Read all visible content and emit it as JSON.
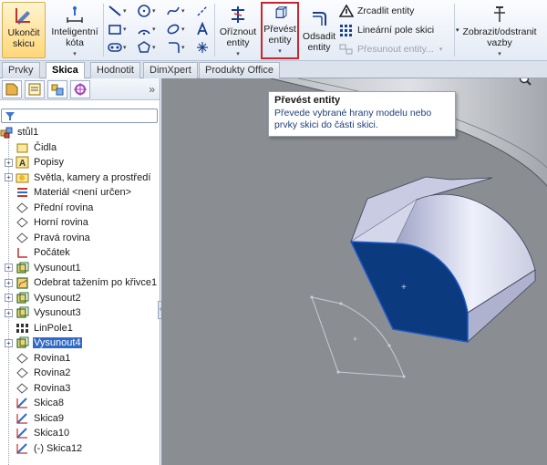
{
  "ribbon": {
    "exit_sketch": "Ukončit\nskicu",
    "smart_dimension": "Inteligentní\nkóta",
    "trim_entities": "Oříznout\nentity",
    "convert_entities": "Převést\nentity",
    "offset_entities": "Odsadit\nentity",
    "mirror_entities": "Zrcadlit entity",
    "linear_pattern": "Lineární pole skici",
    "move_entities": "Přesunout entity...",
    "display_relations": "Zobrazit/odstranit\nvazby"
  },
  "tabs": [
    "Prvky",
    "Skica",
    "Hodnotit",
    "DimXpert",
    "Produkty Office"
  ],
  "active_tab": "Skica",
  "tooltip": {
    "title": "Převést entity",
    "text": "Převede vybrané hrany modelu nebo prvky skici do části skici."
  },
  "tree": {
    "root": "stůl1",
    "items": [
      {
        "label": "Čidla",
        "expandable": false,
        "icon": "sensor-icon"
      },
      {
        "label": "Popisy",
        "expandable": true,
        "icon": "annotations-icon"
      },
      {
        "label": "Světla, kamery a prostředí",
        "expandable": true,
        "icon": "lights-icon"
      },
      {
        "label": "Materiál <není určen>",
        "expandable": false,
        "icon": "material-icon"
      },
      {
        "label": "Přední rovina",
        "expandable": false,
        "icon": "plane-icon"
      },
      {
        "label": "Horní rovina",
        "expandable": false,
        "icon": "plane-icon"
      },
      {
        "label": "Pravá rovina",
        "expandable": false,
        "icon": "plane-icon"
      },
      {
        "label": "Počátek",
        "expandable": false,
        "icon": "origin-icon"
      },
      {
        "label": "Vysunout1",
        "expandable": true,
        "icon": "extrude-icon"
      },
      {
        "label": "Odebrat tažením po křivce1",
        "expandable": true,
        "icon": "sweep-cut-icon"
      },
      {
        "label": "Vysunout2",
        "expandable": true,
        "icon": "extrude-icon"
      },
      {
        "label": "Vysunout3",
        "expandable": true,
        "icon": "extrude-icon"
      },
      {
        "label": "LinPole1",
        "expandable": false,
        "icon": "linear-pattern-icon"
      },
      {
        "label": "Vysunout4",
        "expandable": true,
        "icon": "extrude-icon",
        "selected": true
      },
      {
        "label": "Rovina1",
        "expandable": false,
        "icon": "plane-icon"
      },
      {
        "label": "Rovina2",
        "expandable": false,
        "icon": "plane-icon"
      },
      {
        "label": "Rovina3",
        "expandable": false,
        "icon": "plane-icon"
      },
      {
        "label": "Skica8",
        "expandable": false,
        "icon": "sketch-icon"
      },
      {
        "label": "Skica9",
        "expandable": false,
        "icon": "sketch-icon"
      },
      {
        "label": "Skica10",
        "expandable": false,
        "icon": "sketch-icon"
      },
      {
        "label": "(-) Skica12",
        "expandable": false,
        "icon": "sketch-icon"
      }
    ]
  },
  "colors": {
    "selected_face": "#0c3a7e",
    "viewport_bg": "#8a8d92",
    "highlight_border": "#c8262c",
    "tree_selection": "#3169c6"
  }
}
